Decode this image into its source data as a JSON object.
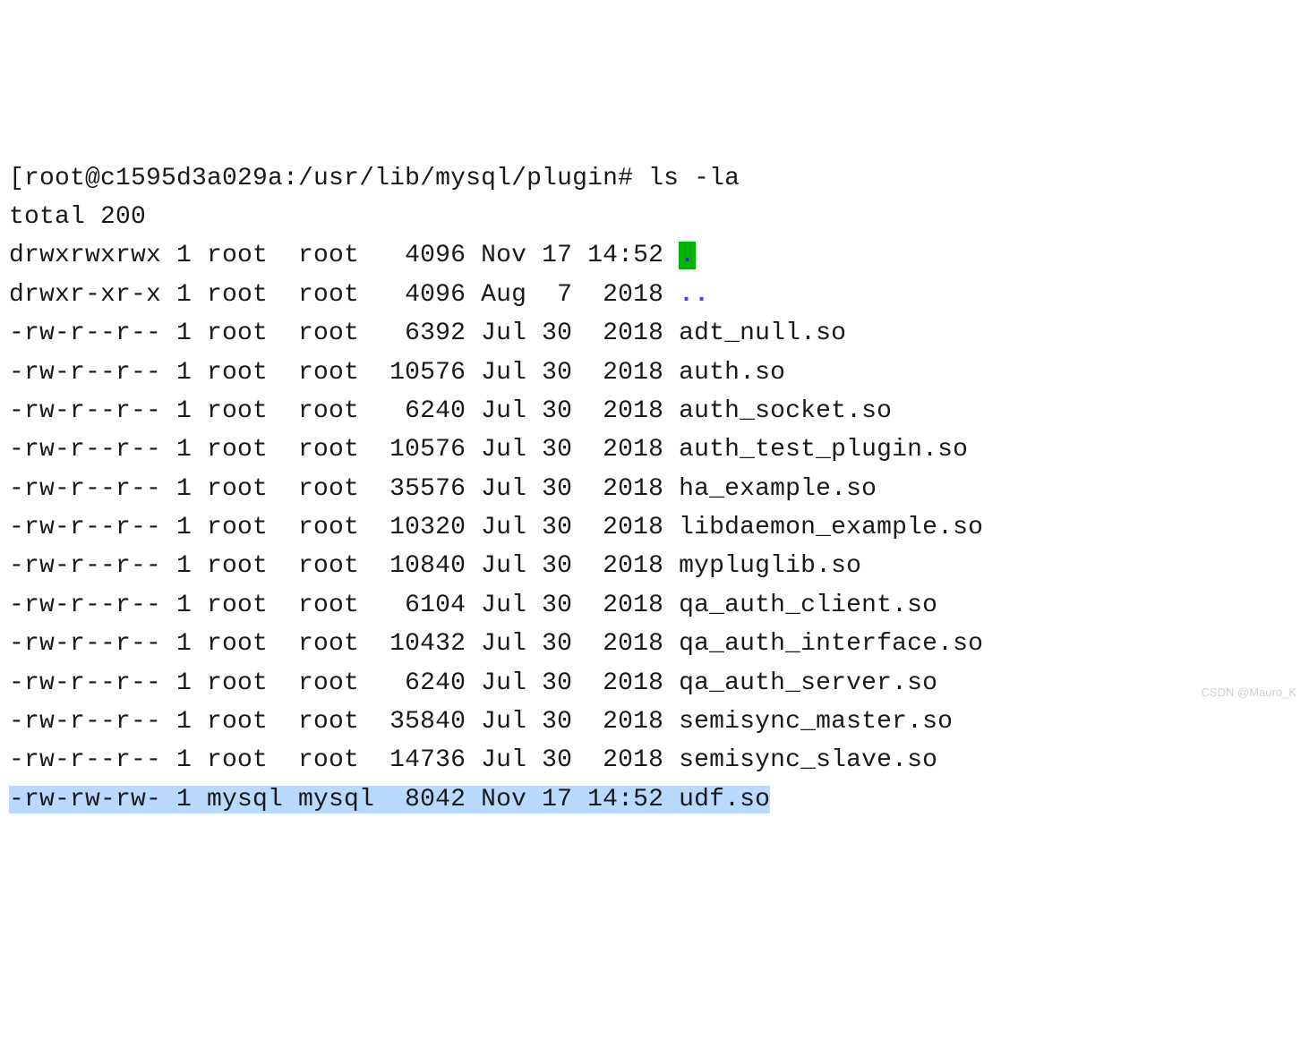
{
  "prompt": {
    "text": "[root@c1595d3a029a:/usr/lib/mysql/plugin# ls -la"
  },
  "total_line": "total 200",
  "rows": [
    {
      "perm": "drwxrwxrwx",
      "links": "1",
      "owner": "root ",
      "group": "root ",
      "size": " 4096",
      "month": "Nov",
      "day": "17",
      "time": "14:52",
      "name": ".",
      "name_class": "hl-green-bg",
      "row_class": ""
    },
    {
      "perm": "drwxr-xr-x",
      "links": "1",
      "owner": "root ",
      "group": "root ",
      "size": " 4096",
      "month": "Aug",
      "day": " 7",
      "time": " 2018",
      "name": "..",
      "name_class": "blue-bold",
      "row_class": ""
    },
    {
      "perm": "-rw-r--r--",
      "links": "1",
      "owner": "root ",
      "group": "root ",
      "size": " 6392",
      "month": "Jul",
      "day": "30",
      "time": " 2018",
      "name": "adt_null.so",
      "name_class": "",
      "row_class": ""
    },
    {
      "perm": "-rw-r--r--",
      "links": "1",
      "owner": "root ",
      "group": "root ",
      "size": "10576",
      "month": "Jul",
      "day": "30",
      "time": " 2018",
      "name": "auth.so",
      "name_class": "",
      "row_class": ""
    },
    {
      "perm": "-rw-r--r--",
      "links": "1",
      "owner": "root ",
      "group": "root ",
      "size": " 6240",
      "month": "Jul",
      "day": "30",
      "time": " 2018",
      "name": "auth_socket.so",
      "name_class": "",
      "row_class": ""
    },
    {
      "perm": "-rw-r--r--",
      "links": "1",
      "owner": "root ",
      "group": "root ",
      "size": "10576",
      "month": "Jul",
      "day": "30",
      "time": " 2018",
      "name": "auth_test_plugin.so",
      "name_class": "",
      "row_class": ""
    },
    {
      "perm": "-rw-r--r--",
      "links": "1",
      "owner": "root ",
      "group": "root ",
      "size": "35576",
      "month": "Jul",
      "day": "30",
      "time": " 2018",
      "name": "ha_example.so",
      "name_class": "",
      "row_class": ""
    },
    {
      "perm": "-rw-r--r--",
      "links": "1",
      "owner": "root ",
      "group": "root ",
      "size": "10320",
      "month": "Jul",
      "day": "30",
      "time": " 2018",
      "name": "libdaemon_example.so",
      "name_class": "",
      "row_class": ""
    },
    {
      "perm": "-rw-r--r--",
      "links": "1",
      "owner": "root ",
      "group": "root ",
      "size": "10840",
      "month": "Jul",
      "day": "30",
      "time": " 2018",
      "name": "mypluglib.so",
      "name_class": "",
      "row_class": ""
    },
    {
      "perm": "-rw-r--r--",
      "links": "1",
      "owner": "root ",
      "group": "root ",
      "size": " 6104",
      "month": "Jul",
      "day": "30",
      "time": " 2018",
      "name": "qa_auth_client.so",
      "name_class": "",
      "row_class": ""
    },
    {
      "perm": "-rw-r--r--",
      "links": "1",
      "owner": "root ",
      "group": "root ",
      "size": "10432",
      "month": "Jul",
      "day": "30",
      "time": " 2018",
      "name": "qa_auth_interface.so",
      "name_class": "",
      "row_class": ""
    },
    {
      "perm": "-rw-r--r--",
      "links": "1",
      "owner": "root ",
      "group": "root ",
      "size": " 6240",
      "month": "Jul",
      "day": "30",
      "time": " 2018",
      "name": "qa_auth_server.so",
      "name_class": "",
      "row_class": ""
    },
    {
      "perm": "-rw-r--r--",
      "links": "1",
      "owner": "root ",
      "group": "root ",
      "size": "35840",
      "month": "Jul",
      "day": "30",
      "time": " 2018",
      "name": "semisync_master.so",
      "name_class": "",
      "row_class": ""
    },
    {
      "perm": "-rw-r--r--",
      "links": "1",
      "owner": "root ",
      "group": "root ",
      "size": "14736",
      "month": "Jul",
      "day": "30",
      "time": " 2018",
      "name": "semisync_slave.so",
      "name_class": "",
      "row_class": ""
    },
    {
      "perm": "-rw-rw-rw-",
      "links": "1",
      "owner": "mysql",
      "group": "mysql",
      "size": " 8042",
      "month": "Nov",
      "day": "17",
      "time": "14:52",
      "name": "udf.so",
      "name_class": "",
      "row_class": "sel"
    }
  ],
  "watermark": "CSDN @Mauro_K"
}
